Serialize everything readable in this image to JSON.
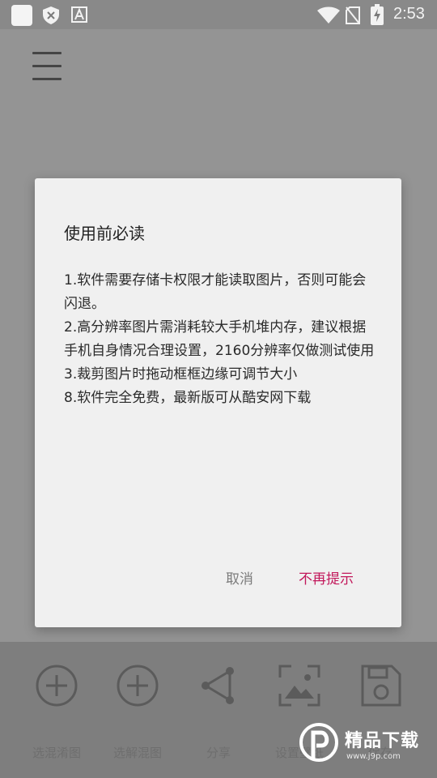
{
  "status_bar": {
    "time": "2:53",
    "icons": [
      "app-square-icon",
      "shield-icon",
      "a-notification-icon",
      "wifi-icon",
      "no-sim-icon",
      "battery-charging-icon"
    ]
  },
  "app": {
    "menu_icon": "hamburger-menu-icon"
  },
  "toolbar": {
    "items": [
      {
        "label": "选混淆图",
        "icon": "plus-circle-icon"
      },
      {
        "label": "选解混图",
        "icon": "plus-circle-icon"
      },
      {
        "label": "分享",
        "icon": "share-icon"
      },
      {
        "label": "设置壁纸",
        "icon": "wallpaper-icon"
      },
      {
        "label": "保存",
        "icon": "save-icon"
      }
    ]
  },
  "dialog": {
    "title": "使用前必读",
    "lines": [
      "1.软件需要存储卡权限才能读取图片，否则可能会闪退。",
      "2.高分辨率图片需消耗较大手机堆内存，建议根据手机自身情况合理设置，2160分辨率仅做测试使用",
      "3.裁剪图片时拖动框框边缘可调节大小",
      "8.软件完全免费，最新版可从酷安网下载"
    ],
    "cancel_label": "取消",
    "dont_show_label": "不再提示",
    "accent_color": "#c2185b"
  },
  "watermark": {
    "text": "精品下载",
    "url": "www.j9p.com"
  }
}
